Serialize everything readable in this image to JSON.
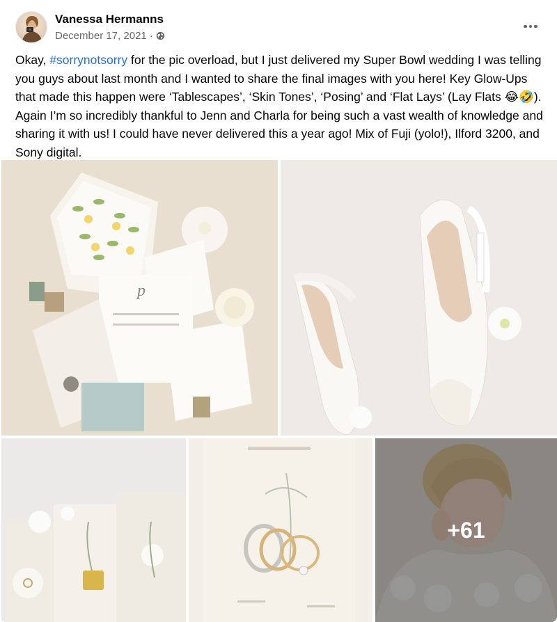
{
  "post": {
    "author": "Vanessa Hermanns",
    "date": "December 17, 2021",
    "separator": "·",
    "privacy_icon": "globe-icon",
    "more_icon": "more-options-icon",
    "text_before": "Okay, ",
    "hashtag": "#sorrynotsorry",
    "text_after": " for the pic overload, but I just delivered my Super Bowl wedding I was telling you guys about last month and I wanted to share the final images with you here! Key Glow-Ups that made this happen were ‘Tablescapes’, ‘Skin Tones’, ‘Posing’ and ‘Flat Lays’ (Lay Flats 😂🤣). Again I’m so incredibly thankful to Jenn and Charla for being such a vast wealth of knowledge and sharing it with us! I could have never delivered this a year ago! Mix of Fuji (yolo!), Ilford 3200, and Sony digital."
  },
  "photos": {
    "more_count": "+61"
  },
  "colors": {
    "hashtag": "#216fdb",
    "secondary_text": "#65676b"
  }
}
